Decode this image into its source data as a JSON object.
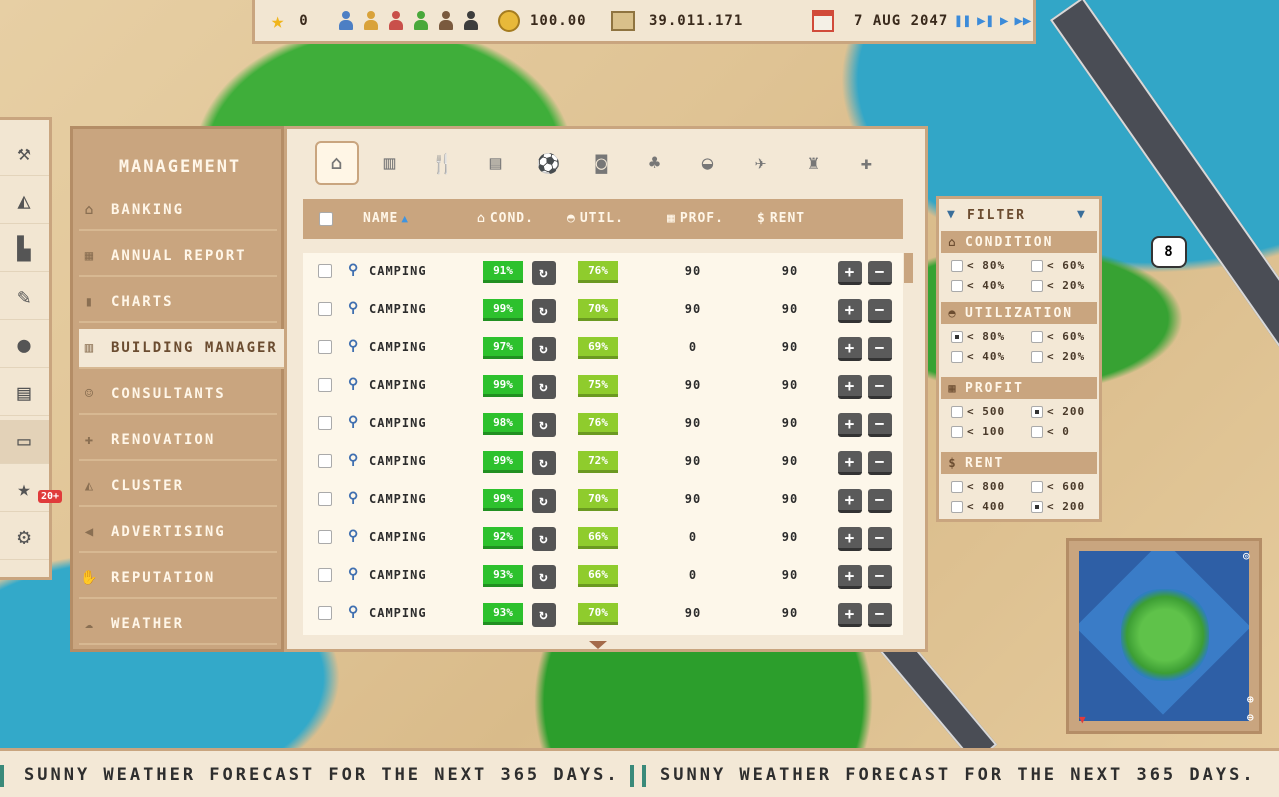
{
  "topbar": {
    "stars": "0",
    "guest_types": [
      {
        "icon": "tourist-icon",
        "color": "#4d7fc4"
      },
      {
        "icon": "woman-icon",
        "color": "#d9a23a"
      },
      {
        "icon": "woman-red-icon",
        "color": "#c9504a"
      },
      {
        "icon": "frog-icon",
        "color": "#49a83b"
      },
      {
        "icon": "man-brown-icon",
        "color": "#7a5a3e"
      },
      {
        "icon": "man-dark-icon",
        "color": "#3d3d3d"
      }
    ],
    "rating": "100.00",
    "money": "39.011.171",
    "date": "7 AUG 2047"
  },
  "toolbar": {
    "tools": [
      {
        "icon": "hammer-wrench-icon",
        "glyph": "⚒"
      },
      {
        "icon": "shark-fin-icon",
        "glyph": "◭"
      },
      {
        "icon": "bulldozer-icon",
        "glyph": "▙"
      },
      {
        "icon": "pencil-icon",
        "glyph": "✎"
      },
      {
        "icon": "bomb-icon",
        "glyph": "●"
      },
      {
        "icon": "blueprint-icon",
        "glyph": "▤"
      },
      {
        "icon": "cash-icon",
        "glyph": "▭"
      },
      {
        "icon": "star-icon",
        "glyph": "★"
      },
      {
        "icon": "gear-icon",
        "glyph": "⚙"
      }
    ],
    "badge": "20+"
  },
  "management": {
    "title": "MANAGEMENT",
    "items": [
      {
        "label": "BANKING",
        "icon": "bank-icon",
        "glyph": "⌂"
      },
      {
        "label": "ANNUAL REPORT",
        "icon": "report-icon",
        "glyph": "▦"
      },
      {
        "label": "CHARTS",
        "icon": "chart-icon",
        "glyph": "▮"
      },
      {
        "label": "BUILDING MANAGER",
        "icon": "building-icon",
        "glyph": "▥"
      },
      {
        "label": "CONSULTANTS",
        "icon": "consultants-icon",
        "glyph": "☺"
      },
      {
        "label": "RENOVATION",
        "icon": "bandage-icon",
        "glyph": "✚"
      },
      {
        "label": "CLUSTER",
        "icon": "cluster-icon",
        "glyph": "◭"
      },
      {
        "label": "ADVERTISING",
        "icon": "megaphone-icon",
        "glyph": "◀"
      },
      {
        "label": "REPUTATION",
        "icon": "handshake-icon",
        "glyph": "✋"
      },
      {
        "label": "WEATHER",
        "icon": "weather-icon",
        "glyph": "☁"
      }
    ],
    "active": "BUILDING MANAGER"
  },
  "categories": [
    {
      "icon": "house-icon",
      "glyph": "⌂"
    },
    {
      "icon": "hotel-icon",
      "glyph": "▥"
    },
    {
      "icon": "restaurant-icon",
      "glyph": "🍴"
    },
    {
      "icon": "shop-icon",
      "glyph": "▤"
    },
    {
      "icon": "soccer-icon",
      "glyph": "⚽"
    },
    {
      "icon": "camera-icon",
      "glyph": "◙"
    },
    {
      "icon": "tree-icon",
      "glyph": "♣"
    },
    {
      "icon": "car-icon",
      "glyph": "◒"
    },
    {
      "icon": "plane-icon",
      "glyph": "✈"
    },
    {
      "icon": "lighthouse-icon",
      "glyph": "♜"
    },
    {
      "icon": "first-aid-icon",
      "glyph": "✚"
    }
  ],
  "table": {
    "headers": {
      "name": "NAME",
      "cond": "COND.",
      "util": "UTIL.",
      "prof": "PROF.",
      "rent": "RENT"
    },
    "rows": [
      {
        "name": "CAMPING",
        "cond": "91%",
        "util": "76%",
        "prof": "90",
        "rent": "90"
      },
      {
        "name": "CAMPING",
        "cond": "99%",
        "util": "70%",
        "prof": "90",
        "rent": "90"
      },
      {
        "name": "CAMPING",
        "cond": "97%",
        "util": "69%",
        "prof": "0",
        "rent": "90"
      },
      {
        "name": "CAMPING",
        "cond": "99%",
        "util": "75%",
        "prof": "90",
        "rent": "90"
      },
      {
        "name": "CAMPING",
        "cond": "98%",
        "util": "76%",
        "prof": "90",
        "rent": "90"
      },
      {
        "name": "CAMPING",
        "cond": "99%",
        "util": "72%",
        "prof": "90",
        "rent": "90"
      },
      {
        "name": "CAMPING",
        "cond": "99%",
        "util": "70%",
        "prof": "90",
        "rent": "90"
      },
      {
        "name": "CAMPING",
        "cond": "92%",
        "util": "66%",
        "prof": "0",
        "rent": "90"
      },
      {
        "name": "CAMPING",
        "cond": "93%",
        "util": "66%",
        "prof": "0",
        "rent": "90"
      },
      {
        "name": "CAMPING",
        "cond": "93%",
        "util": "70%",
        "prof": "90",
        "rent": "90"
      }
    ]
  },
  "filter": {
    "title": "FILTER",
    "sections": [
      {
        "label": "CONDITION",
        "icon": "house-icon",
        "glyph": "⌂",
        "options": [
          {
            "label": "< 80%",
            "checked": false
          },
          {
            "label": "< 60%",
            "checked": false
          },
          {
            "label": "< 40%",
            "checked": false
          },
          {
            "label": "< 20%",
            "checked": false
          }
        ]
      },
      {
        "label": "UTILIZATION",
        "icon": "gauge-icon",
        "glyph": "◓",
        "options": [
          {
            "label": "< 80%",
            "checked": true
          },
          {
            "label": "< 60%",
            "checked": false
          },
          {
            "label": "< 40%",
            "checked": false
          },
          {
            "label": "< 20%",
            "checked": false
          }
        ]
      },
      {
        "label": "PROFIT",
        "icon": "money-icon",
        "glyph": "▦",
        "options": [
          {
            "label": "< 500",
            "checked": false
          },
          {
            "label": "< 200",
            "checked": true
          },
          {
            "label": "< 100",
            "checked": false
          },
          {
            "label": "< 0",
            "checked": false
          }
        ]
      },
      {
        "label": "RENT",
        "icon": "money-bag-icon",
        "glyph": "$",
        "options": [
          {
            "label": "< 800",
            "checked": false
          },
          {
            "label": "< 600",
            "checked": false
          },
          {
            "label": "< 400",
            "checked": false
          },
          {
            "label": "< 200",
            "checked": true
          }
        ]
      }
    ]
  },
  "bubble": "8",
  "ticker": {
    "messages": [
      "SUNNY WEATHER FORECAST FOR THE NEXT 365 DAYS.",
      "SUNNY WEATHER FORECAST FOR THE NEXT 365 DAYS."
    ]
  }
}
